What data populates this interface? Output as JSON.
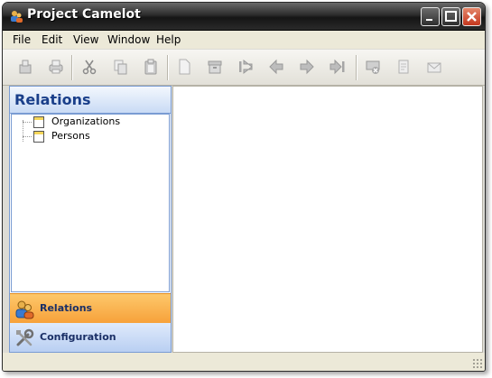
{
  "window": {
    "title": "Project Camelot"
  },
  "menu": [
    "File",
    "Edit",
    "View",
    "Window",
    "Help"
  ],
  "toolbar": {
    "groups": [
      [
        "new-icon",
        "print-icon"
      ],
      [
        "cut-icon",
        "copy-icon",
        "paste-icon"
      ],
      [
        "blank-document-icon",
        "archive-icon",
        "first-icon",
        "previous-icon",
        "next-icon",
        "last-icon"
      ],
      [
        "delete-record-icon",
        "document-icon",
        "mail-icon"
      ]
    ]
  },
  "sidebar": {
    "header": "Relations",
    "tree": [
      {
        "label": "Organizations"
      },
      {
        "label": "Persons"
      }
    ],
    "nav": [
      {
        "label": "Relations",
        "active": true,
        "icon": "users-icon"
      },
      {
        "label": "Configuration",
        "active": false,
        "icon": "tools-icon"
      }
    ]
  },
  "colors": {
    "accent": "#1a3f8a",
    "active_nav": "#f7a13a",
    "inactive_nav": "#b9cff2"
  }
}
